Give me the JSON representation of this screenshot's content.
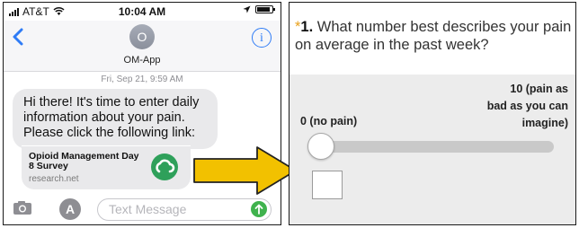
{
  "phone": {
    "status": {
      "carrier": "AT&T",
      "time": "10:04 AM"
    },
    "header": {
      "contact_initial": "O",
      "contact_name": "OM-App",
      "info_glyph": "i"
    },
    "message": {
      "timestamp": "Fri, Sep 21, 9:59 AM",
      "text": "Hi there! It's time to enter daily information about your pain. Please click the following link:",
      "link_title": "Opioid Management Day 8 Survey",
      "link_domain": "research.net"
    },
    "input": {
      "placeholder": "Text Message",
      "appstore_glyph": "A"
    },
    "colors": {
      "accent": "#2f7cf6",
      "send": "#3fb24d",
      "link_icon": "#2ea05a"
    }
  },
  "survey": {
    "question": {
      "required_mark": "*",
      "number": "1.",
      "line1": "What number best describes your pain",
      "line2": "on average in the past week?"
    },
    "scale": {
      "min_label": "0 (no pain)",
      "max_label_lines": [
        "10 (pain as",
        "bad as you can",
        "imagine)"
      ],
      "slider_value": 0
    },
    "colors": {
      "required": "#e8a11c",
      "arrow_fill": "#f2c100"
    }
  }
}
